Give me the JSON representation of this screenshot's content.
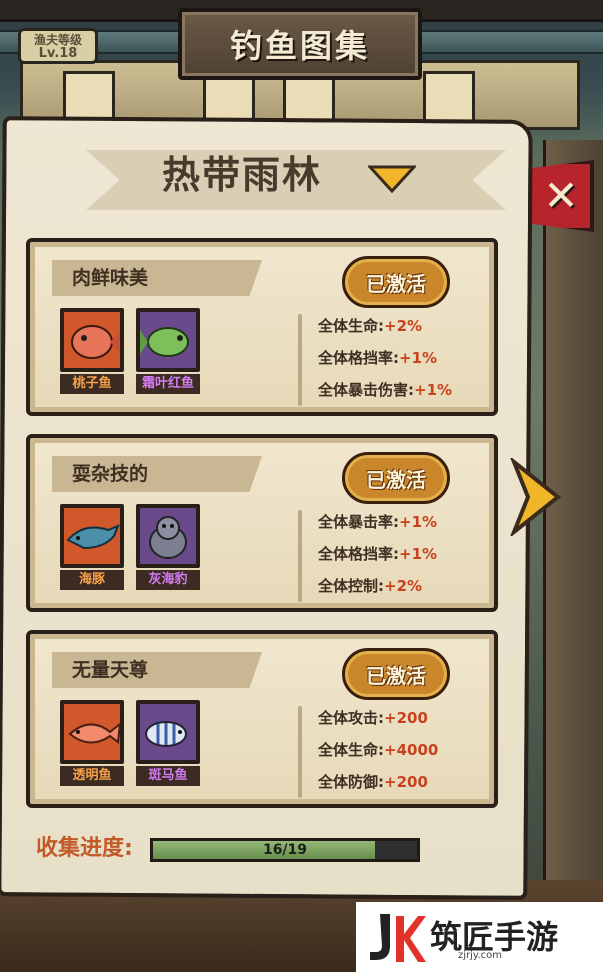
{
  "header": {
    "title": "钓鱼图集",
    "level_label": "渔夫等级",
    "level_value": "Lv.18"
  },
  "region": {
    "name": "热带雨林"
  },
  "sets": [
    {
      "name": "肉鲜味美",
      "status": "已激活",
      "fish": [
        {
          "name": "桃子鱼",
          "rarity": "orange",
          "icon": "peach-fish-icon"
        },
        {
          "name": "霜叶红鱼",
          "rarity": "purple",
          "icon": "frost-leaf-fish-icon"
        }
      ],
      "bonuses": [
        {
          "label": "全体生命:",
          "value": "+2%"
        },
        {
          "label": "全体格挡率:",
          "value": "+1%"
        },
        {
          "label": "全体暴击伤害:",
          "value": "+1%"
        }
      ]
    },
    {
      "name": "耍杂技的",
      "status": "已激活",
      "fish": [
        {
          "name": "海豚",
          "rarity": "orange",
          "icon": "dolphin-icon"
        },
        {
          "name": "灰海豹",
          "rarity": "purple",
          "icon": "grey-seal-icon"
        }
      ],
      "bonuses": [
        {
          "label": "全体暴击率:",
          "value": "+1%"
        },
        {
          "label": "全体格挡率:",
          "value": "+1%"
        },
        {
          "label": "全体控制:",
          "value": "+2%"
        }
      ]
    },
    {
      "name": "无量天尊",
      "status": "已激活",
      "fish": [
        {
          "name": "透明鱼",
          "rarity": "orange",
          "icon": "transparent-fish-icon"
        },
        {
          "name": "斑马鱼",
          "rarity": "purple",
          "icon": "zebra-fish-icon"
        }
      ],
      "bonuses": [
        {
          "label": "全体攻击:",
          "value": "+200"
        },
        {
          "label": "全体生命:",
          "value": "+4000"
        },
        {
          "label": "全体防御:",
          "value": "+200"
        }
      ]
    }
  ],
  "progress": {
    "label": "收集进度:",
    "current": 16,
    "total": 19,
    "text": "16/19",
    "fraction": 0.842
  },
  "watermark": {
    "brand": "筑匠手游",
    "url": "zjrjy.com"
  },
  "colors": {
    "accent_red": "#c9421e",
    "progress_green": "#7fa663",
    "rarity_orange": "#d0582b",
    "rarity_purple": "#6a4a8a",
    "stamp_gold": "#c9862a"
  }
}
